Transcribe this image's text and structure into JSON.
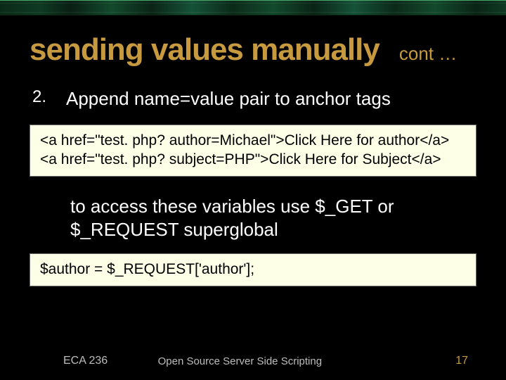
{
  "header": {
    "title": "sending values manually",
    "cont": "cont …"
  },
  "bullet": {
    "number": "2.",
    "text": "Append name=value pair to  anchor tags"
  },
  "code1": {
    "line1": "<a href=\"test. php? author=Michael\">Click Here for author</a>",
    "line2": "<a href=\"test. php? subject=PHP\">Click Here for Subject</a>"
  },
  "subtext": "to access these variables use $_GET or $_REQUEST superglobal",
  "code2": {
    "line1": "$author = $_REQUEST['author'];"
  },
  "footer": {
    "course": "ECA 236",
    "title": "Open Source Server Side Scripting",
    "page": "17"
  }
}
